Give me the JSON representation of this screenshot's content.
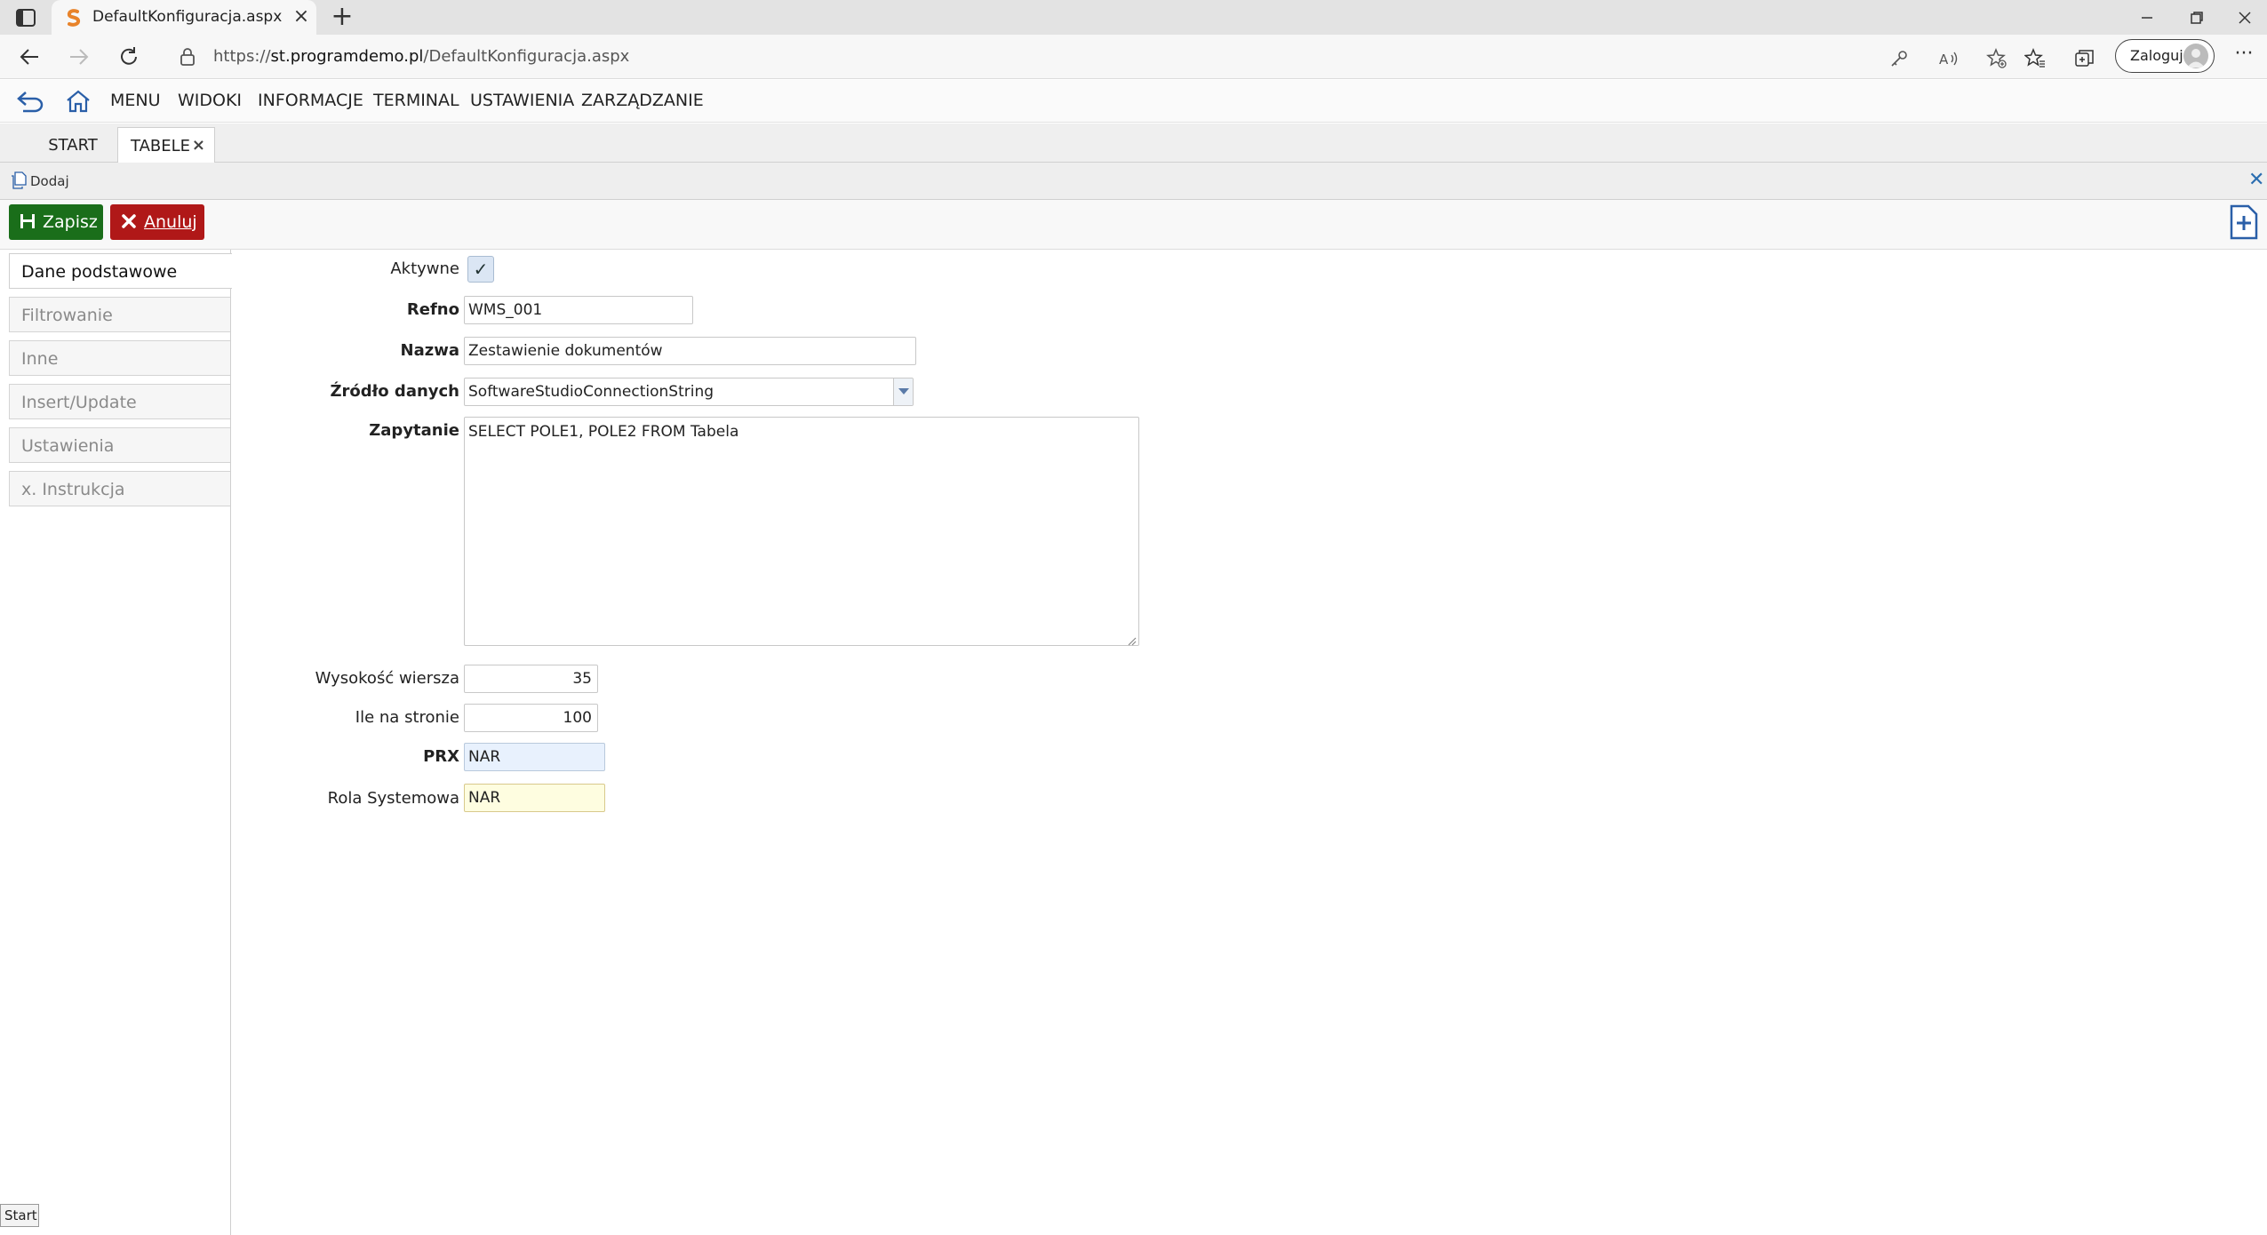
{
  "browser": {
    "tab_title": "DefaultKonfiguracja.aspx",
    "url_prefix": "https://",
    "url_host": "st.programdemo.pl",
    "url_path": "/DefaultKonfiguracja.aspx",
    "login_label": "Zaloguj",
    "more_label": "···"
  },
  "menu": {
    "items": [
      "MENU",
      "WIDOKI",
      "INFORMACJE",
      "TERMINAL",
      "USTAWIENIA",
      "ZARZĄDZANIE"
    ]
  },
  "page_tabs": [
    {
      "label": "START"
    },
    {
      "label": "TABELE",
      "close": "×"
    }
  ],
  "actionbar": {
    "add_label": "Dodaj"
  },
  "toolbar": {
    "save_label": "Zapisz",
    "cancel_label": "Anuluj",
    "save_color": "#1a6e1a",
    "cancel_color": "#b01818"
  },
  "side_tabs": [
    {
      "label": "Dane podstawowe",
      "active": true
    },
    {
      "label": "Filtrowanie"
    },
    {
      "label": "Inne"
    },
    {
      "label": "Insert/Update"
    },
    {
      "label": "Ustawienia"
    },
    {
      "label": "x. Instrukcja"
    }
  ],
  "form": {
    "aktywne": {
      "label": "Aktywne",
      "checked": true,
      "mark": "✓"
    },
    "refno": {
      "label": "Refno",
      "value": "WMS_001"
    },
    "nazwa": {
      "label": "Nazwa",
      "value": "Zestawienie dokumentów"
    },
    "zrodlo": {
      "label": "Źródło danych",
      "value": "SoftwareStudioConnectionString"
    },
    "zapytanie": {
      "label": "Zapytanie",
      "value": "SELECT POLE1, POLE2 FROM Tabela"
    },
    "wysokosc": {
      "label": "Wysokość wiersza",
      "value": "35"
    },
    "ile": {
      "label": "Ile na stronie",
      "value": "100"
    },
    "prx": {
      "label": "PRX",
      "value": "NAR"
    },
    "rola": {
      "label": "Rola Systemowa",
      "value": "NAR"
    }
  },
  "footer": {
    "start_label": "Start"
  }
}
